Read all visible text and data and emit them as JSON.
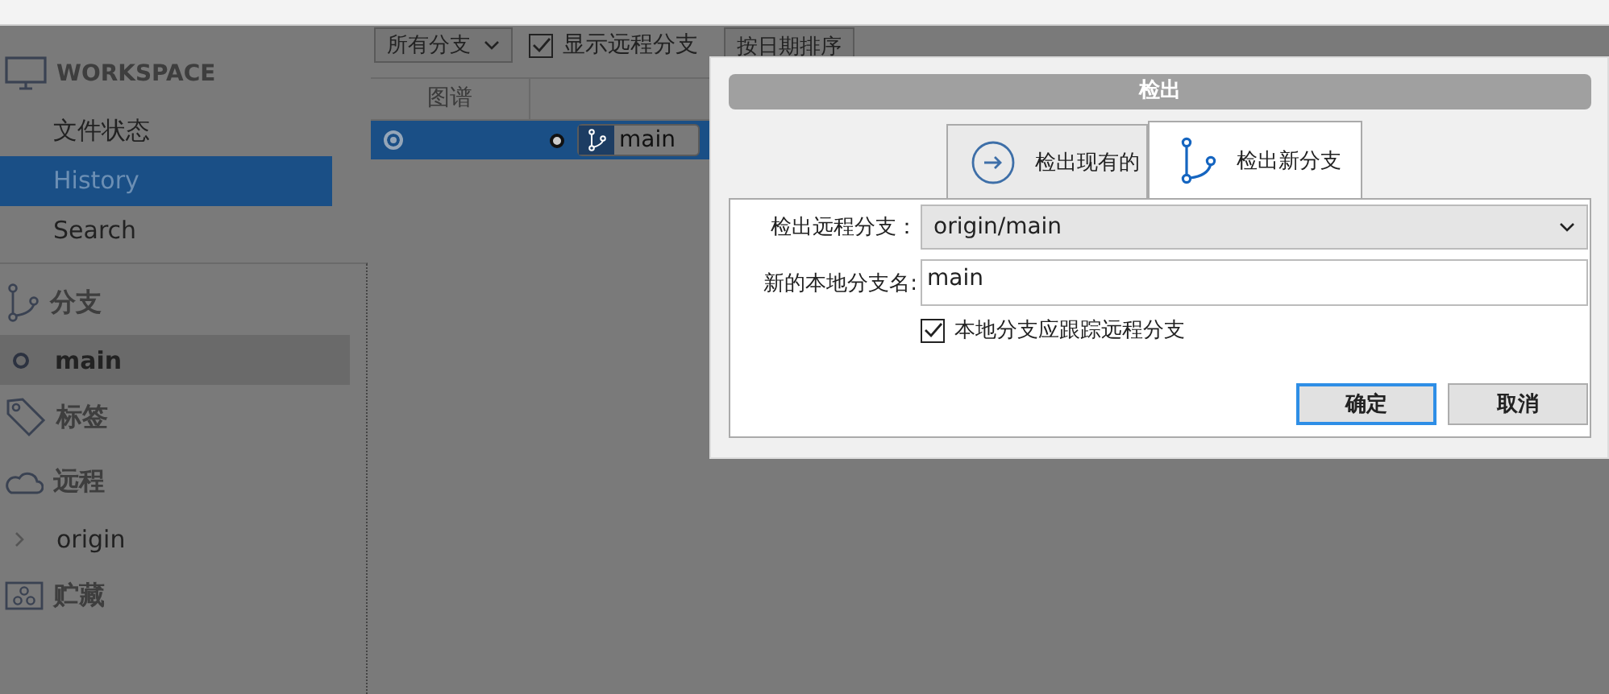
{
  "toolbar": {
    "branch_filter": "所有分支",
    "show_remote": {
      "label": "显示远程分支",
      "checked": true
    },
    "sort": "按日期排序"
  },
  "sidebar": {
    "workspace": {
      "title": "WORKSPACE",
      "items": [
        {
          "label": "文件状态",
          "selected": false
        },
        {
          "label": "History",
          "selected": true
        },
        {
          "label": "Search",
          "selected": false
        }
      ]
    },
    "sections": [
      {
        "kind": "branch",
        "title": "分支",
        "children": [
          {
            "label": "main",
            "selected": true
          }
        ]
      },
      {
        "kind": "tag",
        "title": "标签"
      },
      {
        "kind": "remote",
        "title": "远程",
        "children": [
          {
            "label": "origin",
            "expanded": false
          }
        ]
      },
      {
        "kind": "stash",
        "title": "贮藏"
      }
    ]
  },
  "graph": {
    "columns": [
      "图谱"
    ],
    "rows": [
      {
        "selected": true,
        "branch": "main"
      }
    ]
  },
  "dialog": {
    "title": "检出",
    "tabs": [
      {
        "label": "检出现有的",
        "kind": "existing",
        "selected": false
      },
      {
        "label": "检出新分支",
        "kind": "new",
        "selected": true
      }
    ],
    "remote_branch": {
      "label": "检出远程分支：",
      "value": "origin/main"
    },
    "local_name": {
      "label": "新的本地分支名:",
      "value": "main"
    },
    "track": {
      "label": "本地分支应跟踪远程分支",
      "checked": true
    },
    "buttons": [
      {
        "label": "确定",
        "default": true
      },
      {
        "label": "取消",
        "default": false
      }
    ]
  }
}
